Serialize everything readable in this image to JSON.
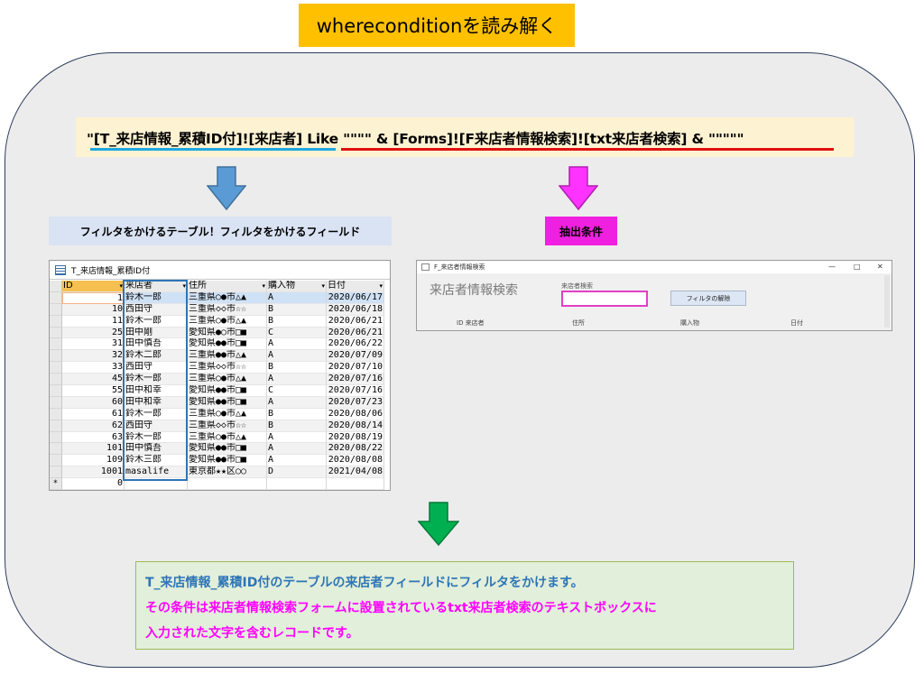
{
  "title": "whereconditionを読み解く",
  "code": {
    "part_field": "\"[T_来店情報_累積ID付]![来店者]",
    "part_condition": " Like \"\"\"\" & [Forms]![F来店者情報検索]![txt来店者検索] & \"\"\"\"\""
  },
  "labels": {
    "field": "フィルタをかけるテーブル！フィルタをかけるフィールド",
    "condition": "抽出条件"
  },
  "table": {
    "tab_name": "T_来店情報_累積ID付",
    "columns": [
      "ID",
      "来店者",
      "住所",
      "購入物",
      "日付"
    ],
    "rows": [
      [
        "1",
        "鈴木一郎",
        "三重県○●市△▲",
        "A",
        "2020/06/17"
      ],
      [
        "10",
        "西田守",
        "三重県◇◇市☆☆",
        "B",
        "2020/06/18"
      ],
      [
        "11",
        "鈴木一郎",
        "三重県○●市△▲",
        "B",
        "2020/06/21"
      ],
      [
        "25",
        "田中剛",
        "愛知県●○市□■",
        "C",
        "2020/06/21"
      ],
      [
        "31",
        "田中慎吾",
        "愛知県●●市□■",
        "A",
        "2020/06/22"
      ],
      [
        "32",
        "鈴木二郎",
        "三重県●●市△▲",
        "A",
        "2020/07/09"
      ],
      [
        "33",
        "西田守",
        "三重県◇◇市☆☆",
        "B",
        "2020/07/10"
      ],
      [
        "45",
        "鈴木一郎",
        "三重県○●市△▲",
        "A",
        "2020/07/16"
      ],
      [
        "55",
        "田中和幸",
        "愛知県●●市□■",
        "C",
        "2020/07/16"
      ],
      [
        "60",
        "田中和幸",
        "愛知県●●市□■",
        "A",
        "2020/07/23"
      ],
      [
        "61",
        "鈴木一郎",
        "三重県○●市△▲",
        "B",
        "2020/08/06"
      ],
      [
        "62",
        "西田守",
        "三重県◇◇市☆☆",
        "B",
        "2020/08/14"
      ],
      [
        "63",
        "鈴木一郎",
        "三重県○●市△▲",
        "A",
        "2020/08/19"
      ],
      [
        "101",
        "田中慎吾",
        "愛知県●●市□■",
        "A",
        "2020/08/22"
      ],
      [
        "109",
        "鈴木三郎",
        "愛知県●●市□■",
        "A",
        "2020/08/08"
      ],
      [
        "1001",
        "masalife",
        "東京都★★区○○",
        "D",
        "2021/04/08"
      ]
    ],
    "new_row": {
      "marker": "*",
      "id": "0"
    }
  },
  "form": {
    "window_title": "F_来店者情報検索",
    "controls": [
      "—",
      "□",
      "✕"
    ],
    "header": "来店者情報検索",
    "search_label": "来店者検索",
    "search_value": "",
    "clear_button": "フィルタの解除",
    "columns": [
      "ID 来店者",
      "住所",
      "購入物",
      "日付"
    ]
  },
  "result": {
    "line1": "T_来店情報_累積ID付のテーブルの来店者フィールドにフィルタをかけます。",
    "line2": "その条件は来店者情報検索フォームに設置されているtxt来店者検索のテキストボックスに",
    "line3": "入力された文字を含むレコードです。"
  },
  "colors": {
    "banner": "#ffc000",
    "blue_arrow": "#5b9bd5",
    "magenta_arrow": "#ff33ff",
    "green_arrow": "#00b050",
    "result_line1": "#2e75b6",
    "result_line2": "#ff00ff"
  }
}
